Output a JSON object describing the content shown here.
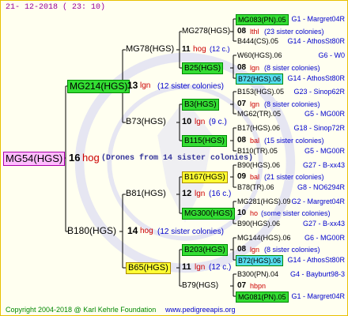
{
  "date": "21- 12-2018 ( 23: 10)",
  "root": {
    "name": "MG54(HGS)",
    "num": "16",
    "gen": "hog",
    "note": "(Drones from 14 sister colonies)"
  },
  "g1": [
    {
      "name": "MG214(HGS)",
      "num": "13",
      "gen": "lgn",
      "note": "(12 sister colonies)"
    },
    {
      "name": "B180(HGS)",
      "num": "14",
      "gen": "hog",
      "note": "(12 sister colonies)"
    }
  ],
  "g2": [
    {
      "name": "MG78(HGS)"
    },
    {
      "name": "B73(HGS)",
      "num": "10",
      "gen": "lgn",
      "note": "(9 c.)"
    },
    {
      "name": "B81(HGS)",
      "num": "12",
      "gen": "lgn",
      "note": "(16 c.)"
    },
    {
      "name": "B65(HGS)",
      "num": "11",
      "gen": "lgn",
      "note": "(12 c.)"
    }
  ],
  "g3": [
    {
      "name": "MG278(HGS)",
      "num": "11",
      "gen": "hog",
      "note": "(12 c.)"
    },
    {
      "name": "B25(HGS)"
    },
    {
      "name": "B3(HGS)"
    },
    {
      "name": "B115(HGS)"
    },
    {
      "name": "B167(HGS)"
    },
    {
      "name": "MG300(HGS)"
    },
    {
      "name": "B203(HGS)"
    },
    {
      "name": "B79(HGS)"
    }
  ],
  "pairs": [
    {
      "num": "08",
      "gen": "lthl",
      "note": "(23 sister colonies)"
    },
    {
      "num": "08",
      "gen": "lgn",
      "note": "(8 sister colonies)"
    },
    {
      "num": "07",
      "gen": "lgn",
      "note": "(8 sister colonies)"
    },
    {
      "num": "08",
      "gen": "bal",
      "note": "(15 sister colonies)"
    },
    {
      "num": "09",
      "gen": "bal",
      "note": "(21 sister colonies)"
    },
    {
      "num": "10",
      "gen": "ho",
      "note": "(some sister colonies)"
    },
    {
      "num": "08",
      "gen": "lgn",
      "note": "(8 sister colonies)"
    },
    {
      "num": "07",
      "gen": "hbpn",
      "note": ""
    }
  ],
  "g4": [
    {
      "name": "MG083(PN).05",
      "ref": "G1 - Margret04R"
    },
    {
      "name": "B444(CS).05",
      "ref": "G14 - AthosSt80R"
    },
    {
      "name": "W60(HGS).06",
      "ref": "G6 - W0"
    },
    {
      "name": "B72(HGS).06",
      "ref": "G14 - AthosSt80R"
    },
    {
      "name": "B153(HGS).05",
      "ref": "G23 - Sinop62R"
    },
    {
      "name": "MG62(TR).05",
      "ref": "G5 - MG00R"
    },
    {
      "name": "B17(HGS).06",
      "ref": "G18 - Sinop72R"
    },
    {
      "name": "B110(TR).05",
      "ref": "G5 - MG00R"
    },
    {
      "name": "B90(HGS).06",
      "ref": "G27 - B-xx43"
    },
    {
      "name": "B78(TR).06",
      "ref": "G8 - NO6294R"
    },
    {
      "name": "MG281(HGS).09",
      "ref": "G2 - Margret04R"
    },
    {
      "name": "B90(HGS).06",
      "ref": "G27 - B-xx43"
    },
    {
      "name": "MG144(HGS).06",
      "ref": "G6 - MG00R"
    },
    {
      "name": "B72(HGS).06",
      "ref": "G14 - AthosSt80R"
    },
    {
      "name": "B300(PN).04",
      "ref": "G4 - Bayburt98-3"
    },
    {
      "name": "MG081(PN).05",
      "ref": "G1 - Margret04R"
    }
  ],
  "footer": {
    "copyright": "Copyright 2004-2018 @ Karl Kehrle Foundation",
    "website": "www.pedigreeapis.org"
  }
}
